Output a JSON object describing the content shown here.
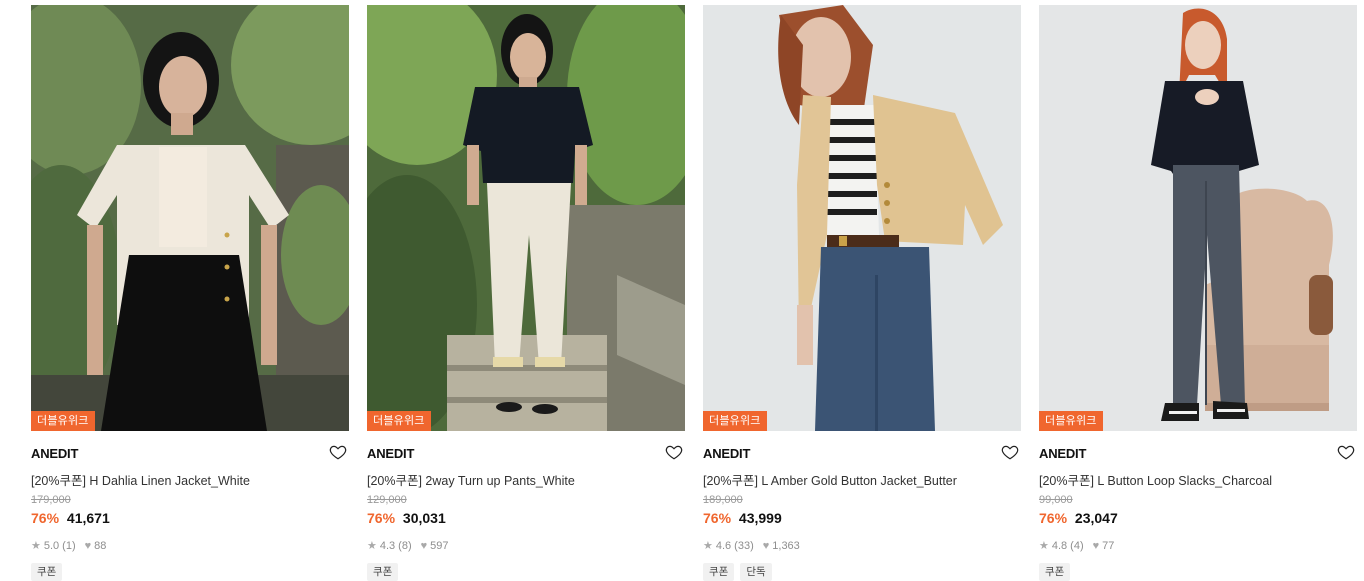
{
  "products": [
    {
      "event_badge": "더블유위크",
      "brand": "ANEDIT",
      "title": "[20%쿠폰] H Dahlia Linen Jacket_White",
      "original_price": "179,000",
      "discount": "76%",
      "price": "41,671",
      "rating": "5.0",
      "review_count": "(1)",
      "likes": "88",
      "tags": [
        "쿠폰"
      ],
      "image_scene": "garden-model-white-jacket"
    },
    {
      "event_badge": "더블유위크",
      "brand": "ANEDIT",
      "title": "[20%쿠폰] 2way Turn up Pants_White",
      "original_price": "129,000",
      "discount": "76%",
      "price": "30,031",
      "rating": "4.3",
      "review_count": "(8)",
      "likes": "597",
      "tags": [
        "쿠폰"
      ],
      "image_scene": "garden-stairs-model-white-pants"
    },
    {
      "event_badge": "더블유위크",
      "brand": "ANEDIT",
      "title": "[20%쿠폰] L Amber Gold Button Jacket_Butter",
      "original_price": "189,000",
      "discount": "76%",
      "price": "43,999",
      "rating": "4.6",
      "review_count": "(33)",
      "likes": "1,363",
      "tags": [
        "쿠폰",
        "단독"
      ],
      "image_scene": "studio-model-butter-jacket"
    },
    {
      "event_badge": "더블유위크",
      "brand": "ANEDIT",
      "title": "[20%쿠폰] L Button Loop Slacks_Charcoal",
      "original_price": "99,000",
      "discount": "76%",
      "price": "23,047",
      "rating": "4.8",
      "review_count": "(4)",
      "likes": "77",
      "tags": [
        "쿠폰"
      ],
      "image_scene": "studio-model-charcoal-slacks-armchair"
    }
  ],
  "colors": {
    "accent": "#f0662e",
    "strike_price": "#9a9a9a",
    "tag_bg": "#f1f1f1"
  },
  "icons": {
    "wishlist": "heart-outline-icon",
    "rating": "star-icon",
    "likes": "heart-filled-icon"
  }
}
